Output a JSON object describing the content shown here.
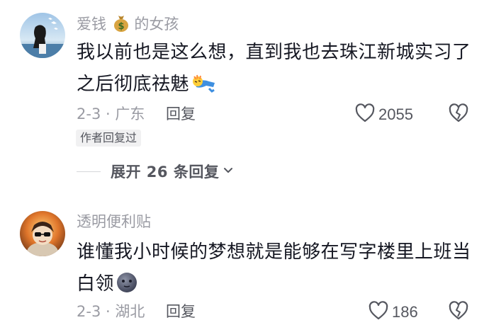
{
  "comments": [
    {
      "username": "爱钱",
      "username_suffix": "的女孩",
      "text_line1": "我以前也是这么想，直到我也去珠江新城实习了",
      "text_line2": "之后彻底祛魅",
      "date_location": "2-3 · 广东",
      "reply_label": "回复",
      "likes": "2055",
      "author_badge": "作者回复过",
      "expand_label": "展开 26 条回复"
    },
    {
      "username": "透明便利贴",
      "text_line1": "谁懂我小时候的梦想就是能够在写字楼里上班当",
      "text_line2": "白领",
      "date_location": "2-3 · 湖北",
      "reply_label": "回复",
      "likes": "186"
    }
  ],
  "icons": {
    "money_bag": "money-bag-emoji",
    "like": "heart-outline-icon",
    "dislike": "broken-heart-outline-icon",
    "expand": "chevron-down-icon",
    "emoji_1": "fainting-emoji",
    "emoji_2": "dark-moon-face-emoji"
  },
  "colors": {
    "secondary_text": "#9a9ba3",
    "primary_text": "#161823",
    "action_text": "#55575f"
  }
}
